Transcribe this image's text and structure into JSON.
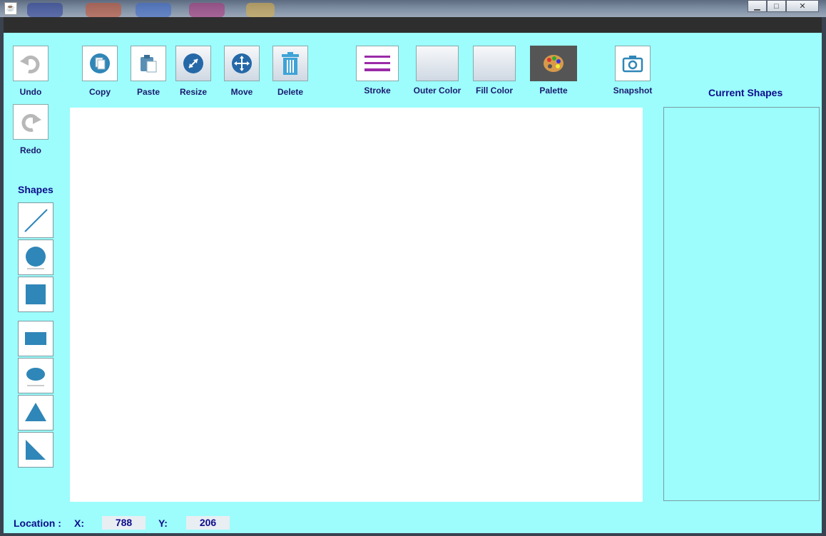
{
  "window": {
    "app_icon": "java-cup-icon",
    "controls": [
      "minimize-icon",
      "maximize-icon",
      "close-icon"
    ]
  },
  "toolbar": {
    "undo_label": "Undo",
    "redo_label": "Redo",
    "copy_label": "Copy",
    "paste_label": "Paste",
    "resize_label": "Resize",
    "move_label": "Move",
    "delete_label": "Delete",
    "stroke_label": "Stroke",
    "outer_color_label": "Outer Color",
    "fill_color_label": "Fill Color",
    "palette_label": "Palette",
    "snapshot_label": "Snapshot"
  },
  "shapes": {
    "heading": "Shapes",
    "items": [
      "line",
      "circle",
      "square",
      "rectangle",
      "ellipse",
      "triangle",
      "right-triangle"
    ]
  },
  "current_shapes": {
    "heading": "Current Shapes"
  },
  "status": {
    "location_label": "Location :",
    "x_label": "X:",
    "x_value": "788",
    "y_label": "Y:",
    "y_value": "206"
  },
  "colors": {
    "panel_bg": "#9cfdfc",
    "accent_text": "#0d0d8c",
    "stroke_icon": "#9b2aa8",
    "shape_blue": "#2f86b8"
  }
}
